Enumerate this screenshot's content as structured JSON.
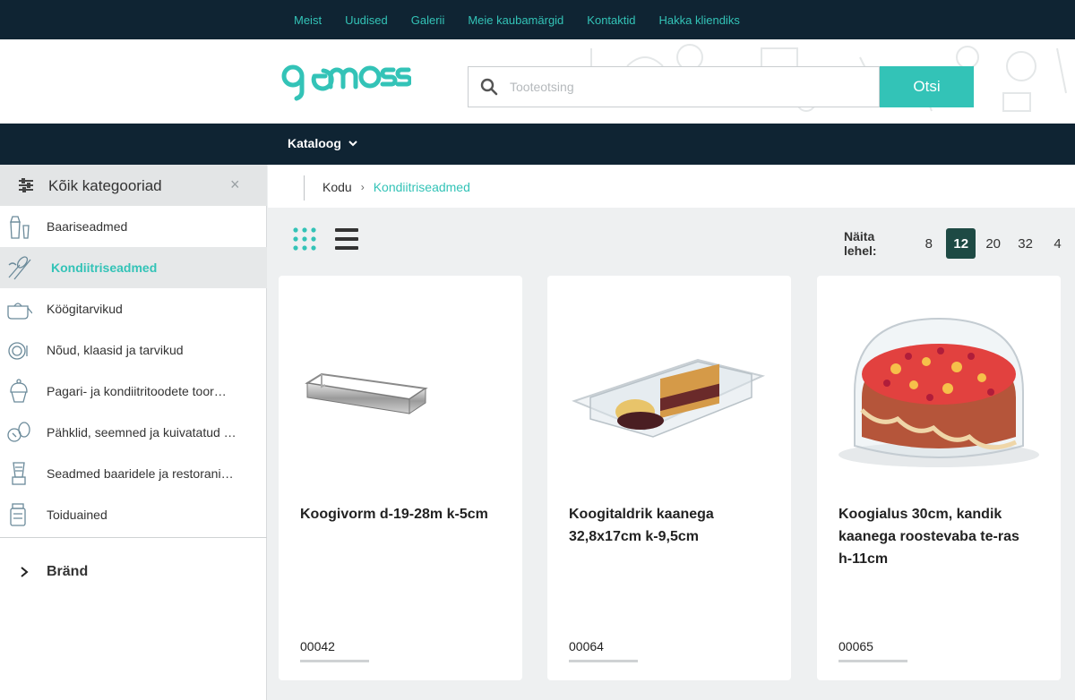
{
  "topnav": [
    "Meist",
    "Uudised",
    "Galerii",
    "Meie kaubamärgid",
    "Kontaktid",
    "Hakka kliendiks"
  ],
  "logo": {
    "text": "qemoss",
    "color": "#33c3b7"
  },
  "search": {
    "placeholder": "Tooteotsing",
    "button": "Otsi"
  },
  "catalog": {
    "label": "Kataloog"
  },
  "sidebar": {
    "title": "Kõik kategooriad",
    "close": "×",
    "items": [
      {
        "label": "Baariseadmed",
        "icon": "shaker-icon"
      },
      {
        "label": "Kondiitriseadmed",
        "icon": "whisk-icon",
        "active": true
      },
      {
        "label": "Köögitarvikud",
        "icon": "pot-icon"
      },
      {
        "label": "Nõud, klaasid ja tarvikud",
        "icon": "plate-icon"
      },
      {
        "label": "Pagari- ja kondiitritoodete toor…",
        "icon": "cupcake-icon"
      },
      {
        "label": "Pähklid, seemned ja kuivatatud …",
        "icon": "nuts-icon"
      },
      {
        "label": "Seadmed baaridele ja restorani…",
        "icon": "blender-icon"
      },
      {
        "label": "Toiduained",
        "icon": "jar-icon"
      }
    ],
    "brand": "Bränd"
  },
  "breadcrumb": {
    "home": "Kodu",
    "separator": "›",
    "current": "Kondiitriseadmed"
  },
  "per_page": {
    "label": "Näita lehel:",
    "options": [
      "8",
      "12",
      "20",
      "32",
      "4"
    ],
    "selected": "12"
  },
  "products": [
    {
      "name": "Koogivorm d-19-28m k-5cm",
      "code": "00042",
      "image": "cake-ring-image"
    },
    {
      "name": "Koogitaldrik kaanega 32,8x17cm k-9,5cm",
      "code": "00064",
      "image": "cake-dish-image"
    },
    {
      "name": "Koogialus 30cm, kandik kaanega roostevaba te-ras h-11cm",
      "code": "00065",
      "image": "cake-stand-image"
    }
  ],
  "colors": {
    "accent": "#33c3b7",
    "dark": "#0f2433",
    "selected": "#1e4a44"
  }
}
